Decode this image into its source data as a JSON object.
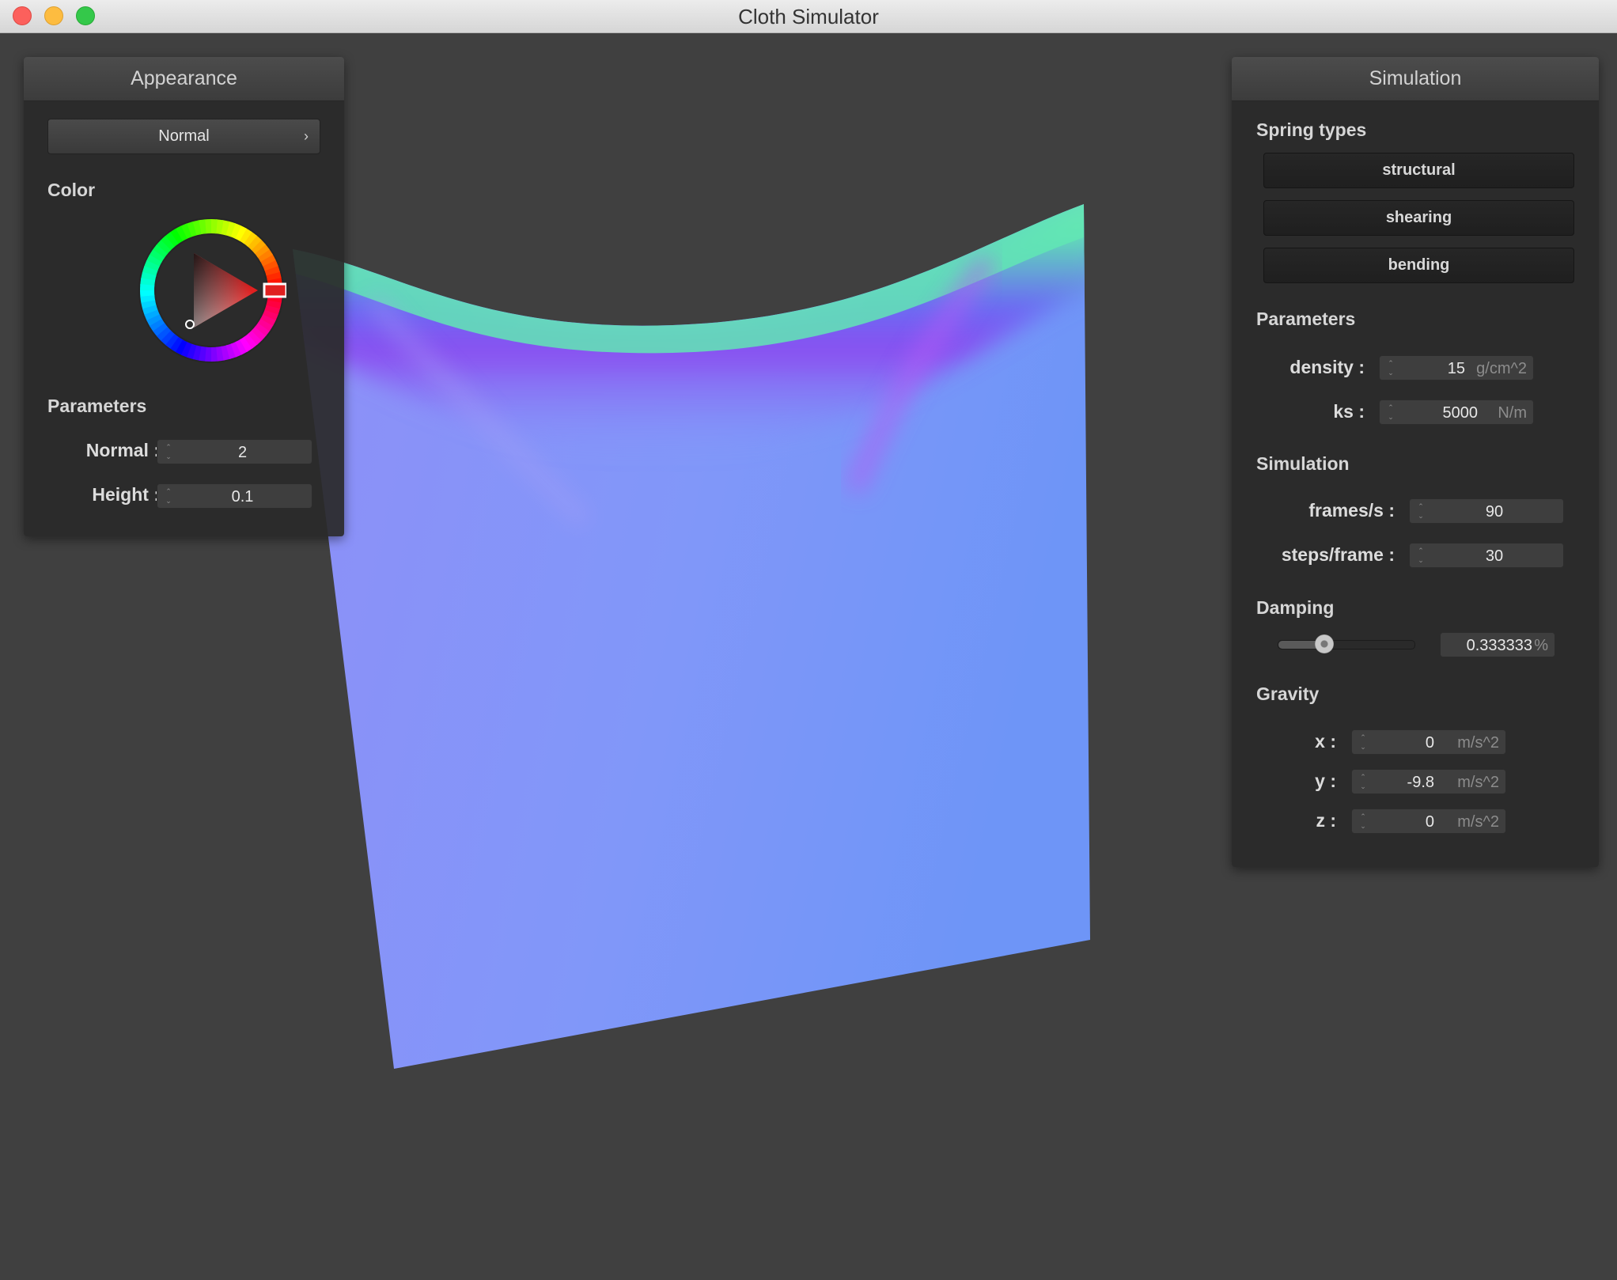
{
  "window": {
    "title": "Cloth Simulator"
  },
  "appearance": {
    "title": "Appearance",
    "shader": "Normal",
    "color_label": "Color",
    "selected_color": "#e02020",
    "params_label": "Parameters",
    "normal_label": "Normal :",
    "normal_value": "2",
    "height_label": "Height :",
    "height_value": "0.1"
  },
  "simulation_panel": {
    "title": "Simulation",
    "spring_types_label": "Spring types",
    "springs": [
      "structural",
      "shearing",
      "bending"
    ],
    "params_label": "Parameters",
    "density_label": "density :",
    "density_value": "15",
    "density_unit": "g/cm^2",
    "ks_label": "ks :",
    "ks_value": "5000",
    "ks_unit": "N/m",
    "sim_label": "Simulation",
    "fps_label": "frames/s :",
    "fps_value": "90",
    "steps_label": "steps/frame :",
    "steps_value": "30",
    "damping_label": "Damping",
    "damping_value": "0.333333",
    "damping_unit": "%",
    "damping_fraction": 0.333333,
    "gravity_label": "Gravity",
    "gx_label": "x :",
    "gx_value": "0",
    "gy_label": "y :",
    "gy_value": "-9.8",
    "gz_label": "z :",
    "gz_value": "0",
    "g_unit": "m/s^2"
  },
  "colors": {
    "cloth_base": "#8290f6",
    "fold_purple": "#7a5cf0",
    "fold_green": "#5fe8b0"
  }
}
